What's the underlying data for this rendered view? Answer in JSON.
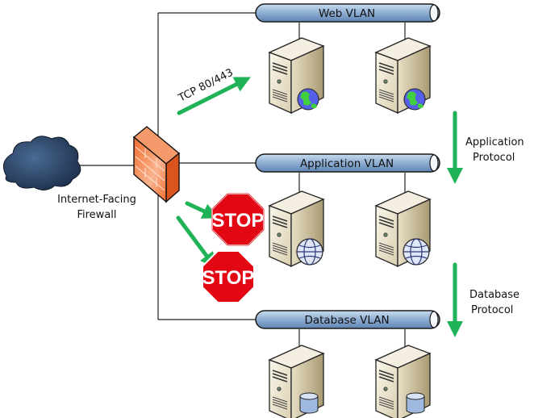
{
  "vlans": [
    {
      "label": "Web VLAN",
      "server_badge": "globe-icon"
    },
    {
      "label": "Application VLAN",
      "server_badge": "wireframe-globe-icon"
    },
    {
      "label": "Database VLAN",
      "server_badge": "database-icon"
    }
  ],
  "cloud": {
    "icon": "internet-cloud-icon"
  },
  "firewall": {
    "label_line1": "Internet-Facing",
    "label_line2": "Firewall",
    "icon": "brick-firewall-icon"
  },
  "arrows": {
    "web_traffic": "TCP 80/443",
    "app_protocol_line1": "Application",
    "app_protocol_line2": "Protocol",
    "db_protocol_line1": "Database",
    "db_protocol_line2": "Protocol"
  },
  "stop_signs": [
    {
      "text": "STOP"
    },
    {
      "text": "STOP"
    }
  ],
  "colors": {
    "arrow": "#1fb257",
    "bus": "#8eaed2",
    "stop": "#e30613",
    "firewall": "#f26b2f"
  }
}
